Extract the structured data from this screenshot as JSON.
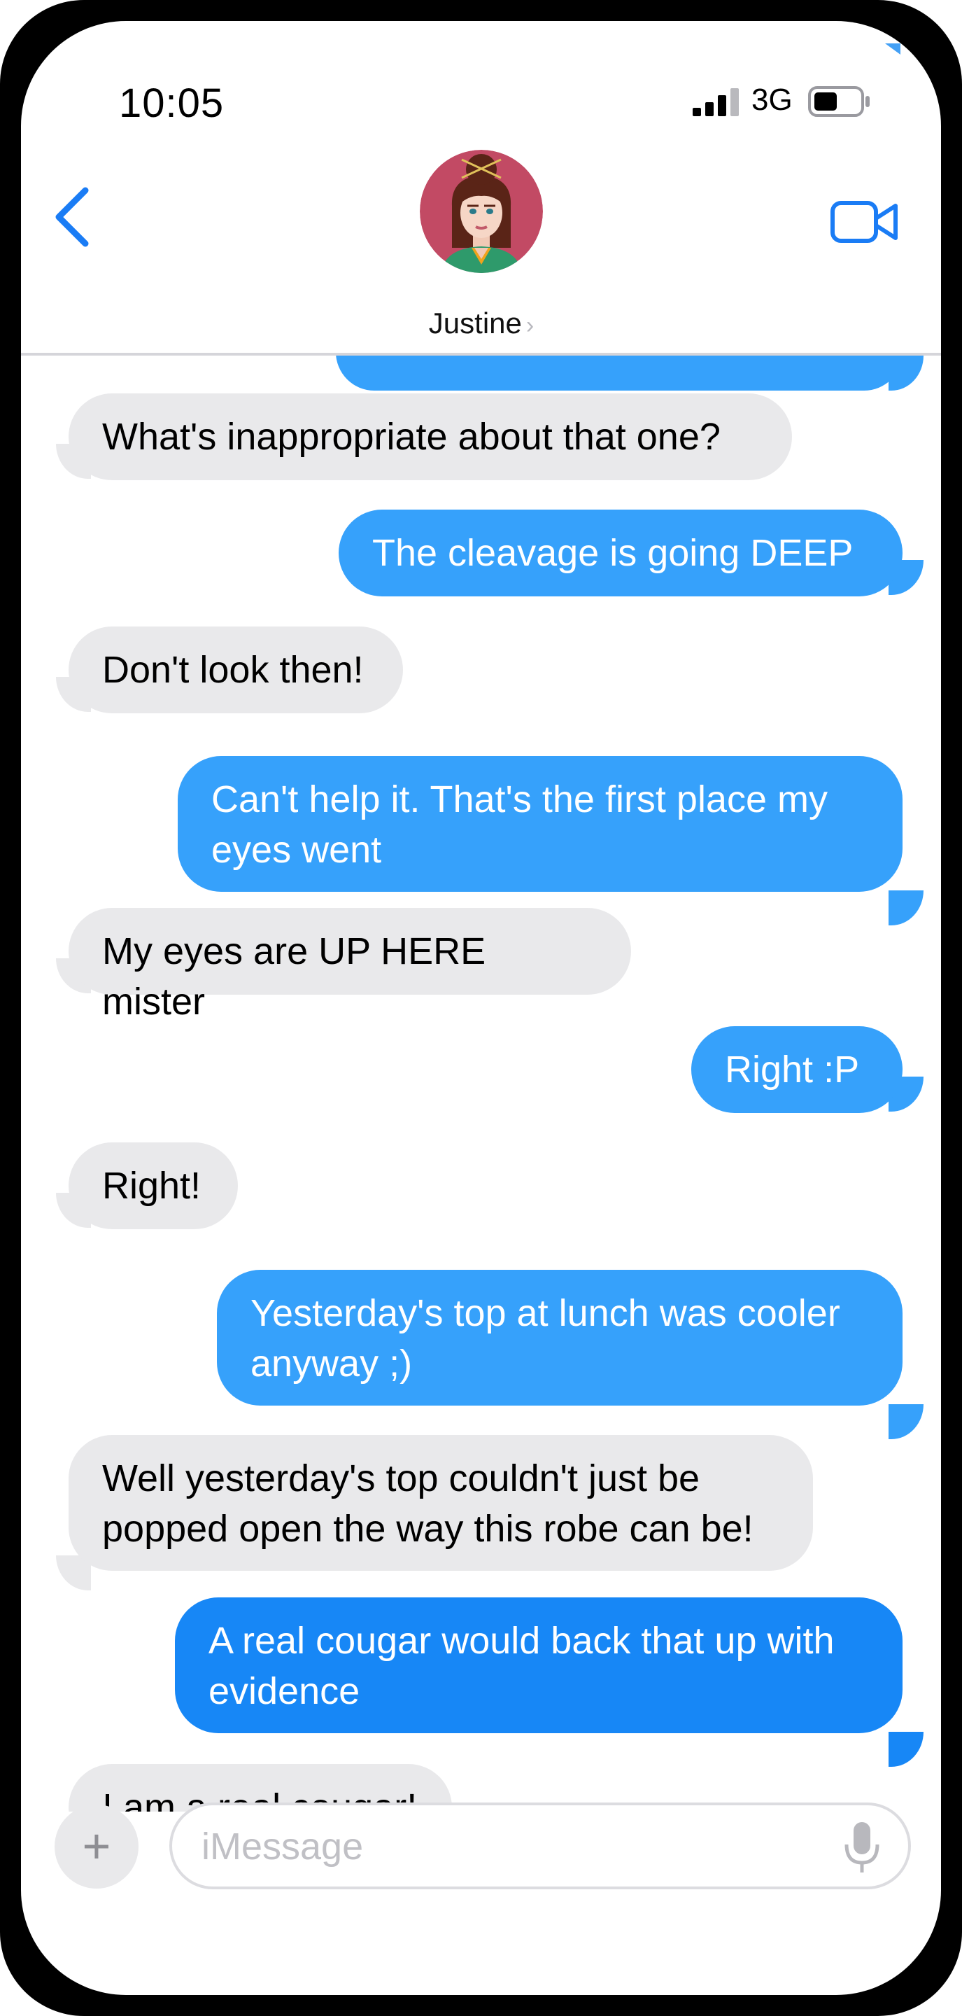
{
  "status_bar": {
    "time": "10:05",
    "network": "3G",
    "icons": [
      "signal-bars-icon",
      "battery-icon"
    ]
  },
  "header": {
    "contact_name": "Justine",
    "chevron": "›",
    "icons": [
      "back-chevron-icon",
      "video-camera-icon"
    ],
    "accent_color": "#1a7cf5"
  },
  "messages": [
    {
      "side": "out",
      "text": ""
    },
    {
      "side": "in",
      "text": "What's inappropriate about that one?"
    },
    {
      "side": "out",
      "text": "The cleavage is going DEEP"
    },
    {
      "side": "in",
      "text": "Don't look then!"
    },
    {
      "side": "out",
      "text": "Can't help it.  That's the first place my\neyes went"
    },
    {
      "side": "in",
      "text": "My eyes are UP HERE mister"
    },
    {
      "side": "out",
      "text": "Right :P"
    },
    {
      "side": "in",
      "text": "Right!"
    },
    {
      "side": "out",
      "text": "Yesterday's top at lunch was cooler\nanyway ;)"
    },
    {
      "side": "in",
      "text": "Well yesterday's top couldn't just be\npopped open the way this robe can be!"
    },
    {
      "side": "out",
      "text": "A real cougar would back that up with\nevidence"
    },
    {
      "side": "in",
      "text": "I am a real cougar!"
    }
  ],
  "colors": {
    "incoming_bubble": "#e9e9eb",
    "outgoing_bubble": "#36a1fb",
    "outgoing_bubble_latest": "#1787f6"
  },
  "input_bar": {
    "placeholder": "iMessage",
    "value": "",
    "icons": [
      "plus-icon",
      "microphone-icon"
    ]
  }
}
